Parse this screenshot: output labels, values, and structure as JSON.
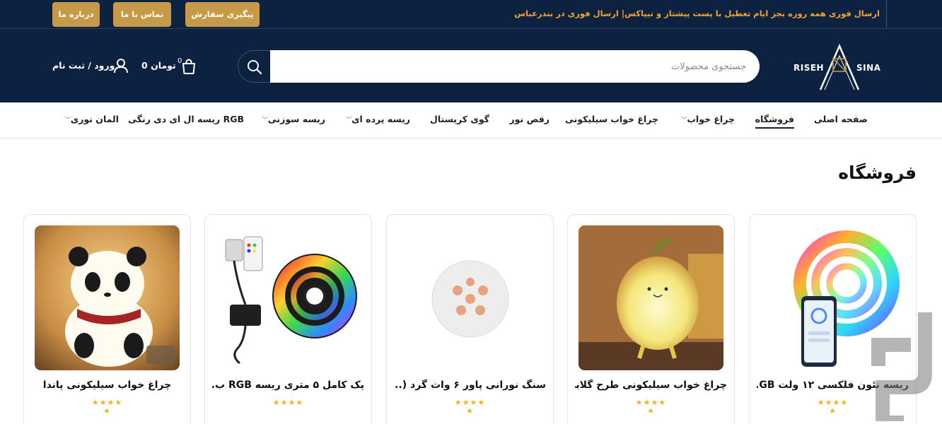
{
  "topbar": {
    "announcement": "ارسال فوری همه روزه بجز ایام تعطیل با پست پیشتاز و تیپاکس| ارسال فوری در بندرعباس",
    "buttons": {
      "track_order": "پیگیری سفارش",
      "contact_us": "تماس با ما",
      "about_us": "درباره ما"
    }
  },
  "header": {
    "logo_left": "RISEH",
    "logo_right": "SINA",
    "search_placeholder": "جستجوی محصولات",
    "cart_count": "0",
    "cart_amount": "0 تومان",
    "login_label": "ورود / ثبت نام"
  },
  "nav": {
    "items": [
      {
        "label": "صفحه اصلی",
        "dropdown": false,
        "active": false
      },
      {
        "label": "فروشگاه",
        "dropdown": false,
        "active": true
      },
      {
        "label": "چراغ خواب",
        "dropdown": true,
        "active": false
      },
      {
        "label": "چراغ خواب سیلیکونی",
        "dropdown": false,
        "active": false
      },
      {
        "label": "رقص نور",
        "dropdown": false,
        "active": false
      },
      {
        "label": "گوی کریستال",
        "dropdown": false,
        "active": false
      },
      {
        "label": "ریسه پرده ای",
        "dropdown": true,
        "active": false
      },
      {
        "label": "ریسه سوزنی",
        "dropdown": true,
        "active": false
      },
      {
        "label": "ریسه ال ای دی رنگی RGB",
        "dropdown": false,
        "active": false
      },
      {
        "label": "المان نوری",
        "dropdown": true,
        "active": false
      }
    ]
  },
  "main": {
    "page_title": "فروشگاه",
    "products": [
      {
        "title": "ریسه نئون فلکسی ۱۲ ولت GB...",
        "rating": 5
      },
      {
        "title": "چراغ خواب سیلیکونی طرح گلابی",
        "rating": 5
      },
      {
        "title": "سنگ نورانی پاور ۶ وات گرد (...",
        "rating": 5
      },
      {
        "title": "پک کامل ۵ متری ریسه RGB ب...",
        "rating": 4
      },
      {
        "title": "چراغ خواب سیلیکونی پاندا",
        "rating": 5
      }
    ]
  },
  "colors": {
    "header_bg": "#0d2240",
    "accent_orange": "#f2a52a",
    "button_gold": "#c79a4a",
    "star": "#f4b12a"
  },
  "icons": [
    "search-icon",
    "cart-icon",
    "user-icon",
    "chevron-down-icon",
    "star-icon"
  ]
}
